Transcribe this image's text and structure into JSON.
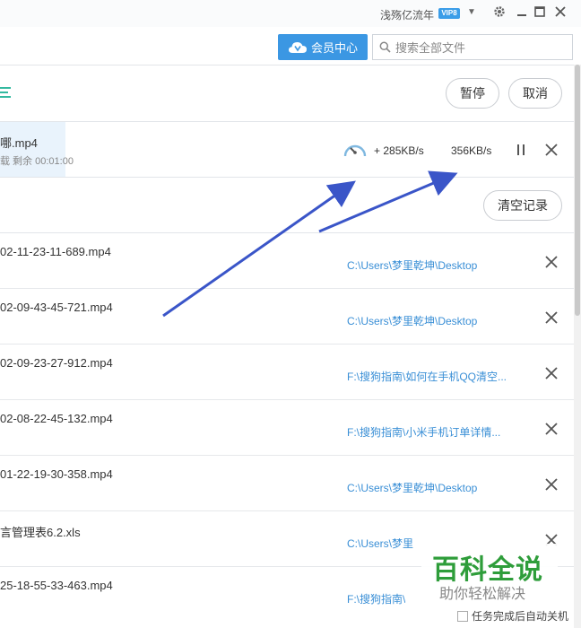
{
  "titlebar": {
    "username": "浅殇亿流年",
    "vip_badge": "VIP8",
    "dropdown_icon": "chevron-down-icon",
    "icons": [
      "gear-icon",
      "minimize-icon",
      "close-icon"
    ]
  },
  "header": {
    "vip_center_label": "会员中心",
    "search_placeholder": "搜索全部文件"
  },
  "toolbar": {
    "pause_label": "暂停",
    "cancel_label": "取消"
  },
  "active_download": {
    "file_name": "哪.mp4",
    "status_text": "载   剩余 00:01:00",
    "speed_boost": "+ 285KB/s",
    "speed": "356KB/s"
  },
  "history": {
    "clear_label": "清空记录",
    "rows": [
      {
        "file": "02-11-23-11-689.mp4",
        "path": "C:\\Users\\梦里乾坤\\Desktop"
      },
      {
        "file": "02-09-43-45-721.mp4",
        "path": "C:\\Users\\梦里乾坤\\Desktop"
      },
      {
        "file": "02-09-23-27-912.mp4",
        "path": "F:\\搜狗指南\\如何在手机QQ清空..."
      },
      {
        "file": "02-08-22-45-132.mp4",
        "path": "F:\\搜狗指南\\小米手机订单详情..."
      },
      {
        "file": "01-22-19-30-358.mp4",
        "path": "C:\\Users\\梦里乾坤\\Desktop"
      },
      {
        "file": "言管理表6.2.xls",
        "path": "C:\\Users\\梦里"
      },
      {
        "file": "25-18-55-33-463.mp4",
        "path": "F:\\搜狗指南\\"
      }
    ]
  },
  "watermark": {
    "title": "百科全说",
    "subtitle": "助你轻松解决"
  },
  "footer": {
    "auto_shutdown_label": "任务完成后自动关机"
  },
  "colors": {
    "accent": "#3b97e3",
    "path_link": "#3a8fd6",
    "arrow": "#3a55c8",
    "watermark_green": "#2e9d3a"
  }
}
